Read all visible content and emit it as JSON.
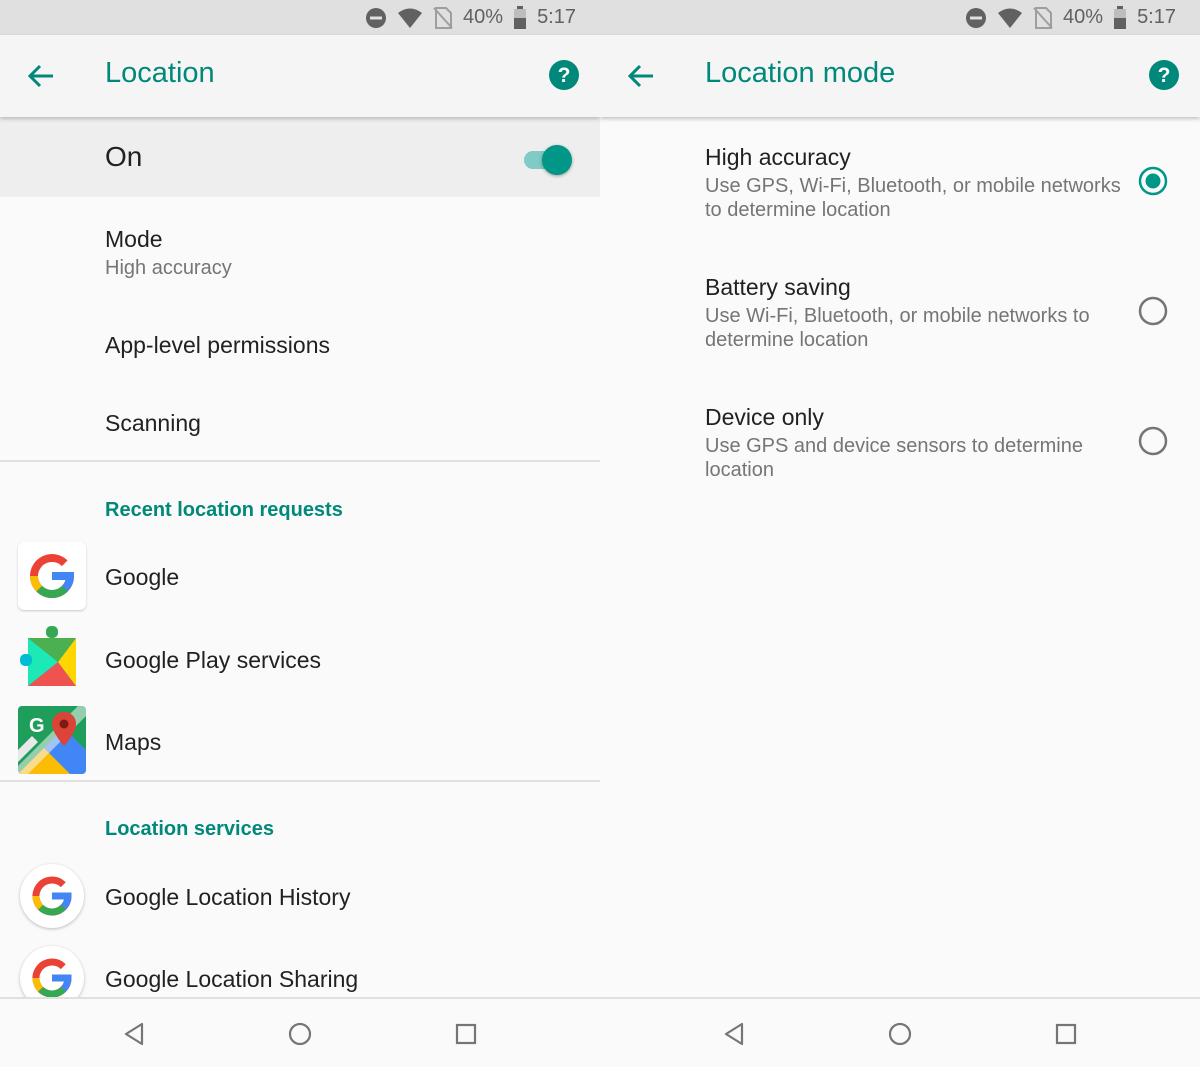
{
  "status_bar": {
    "battery": "40%",
    "time": "5:17"
  },
  "colors": {
    "accent": "#00897b",
    "switch_thumb": "#009688",
    "switch_track": "#80cbc4"
  },
  "left": {
    "title": "Location",
    "master_switch": {
      "label": "On",
      "checked": true
    },
    "mode": {
      "title": "Mode",
      "summary": "High accuracy"
    },
    "app_permissions": "App-level permissions",
    "scanning": "Scanning",
    "recent_header": "Recent location requests",
    "recent_apps": [
      {
        "name": "Google",
        "icon": "google-g-icon"
      },
      {
        "name": "Google Play services",
        "icon": "play-services-icon"
      },
      {
        "name": "Maps",
        "icon": "maps-icon"
      }
    ],
    "services_header": "Location services",
    "services": [
      {
        "name": "Google Location History",
        "icon": "google-g-icon"
      },
      {
        "name": "Google Location Sharing",
        "icon": "google-g-icon"
      }
    ]
  },
  "right": {
    "title": "Location mode",
    "options": [
      {
        "title": "High accuracy",
        "description": "Use GPS, Wi-Fi, Bluetooth, or mobile networks to determine location",
        "selected": true
      },
      {
        "title": "Battery saving",
        "description": "Use Wi-Fi, Bluetooth, or mobile networks to determine location",
        "selected": false
      },
      {
        "title": "Device only",
        "description": "Use GPS and device sensors to determine location",
        "selected": false
      }
    ]
  },
  "nav_bar": {
    "icons": [
      "back-triangle-icon",
      "home-circle-icon",
      "recents-square-icon"
    ]
  }
}
